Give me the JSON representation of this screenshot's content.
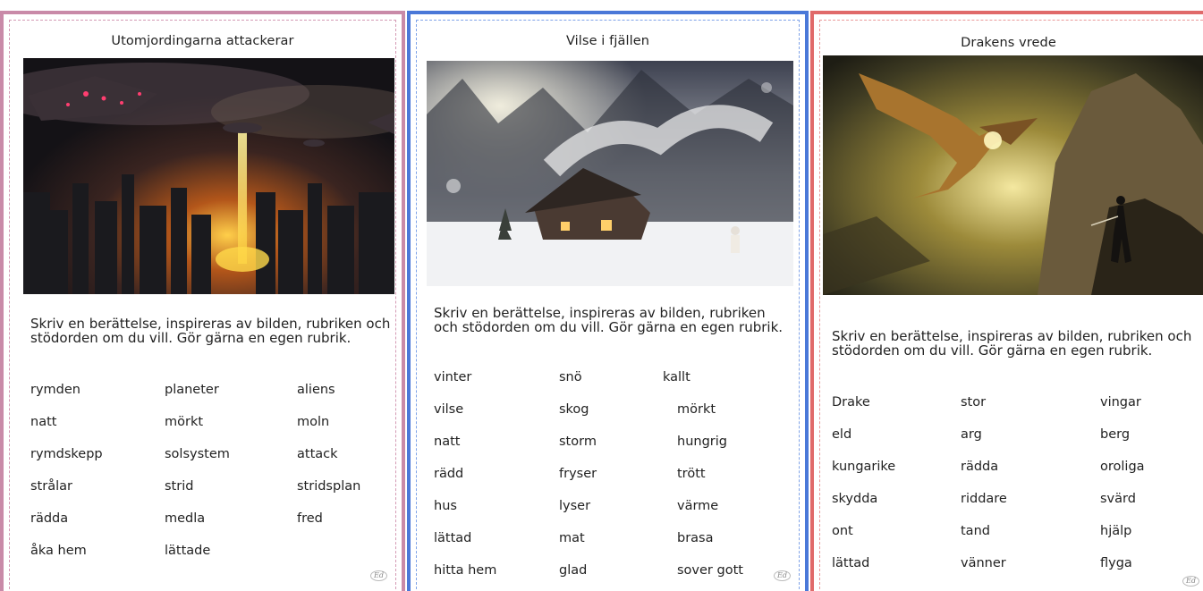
{
  "cards": [
    {
      "title": "Utomjordingarna attackerar",
      "image_subject": "ufo-city-image",
      "prompt": "Skriv en berättelse, inspireras av bilden, rubriken och stödorden om du vill. Gör gärna en egen rubrik.",
      "words": [
        [
          "rymden",
          "planeter",
          "aliens"
        ],
        [
          "natt",
          "mörkt",
          "moln"
        ],
        [
          "rymdskepp",
          "solsystem",
          "attack"
        ],
        [
          "strålar",
          "strid",
          "stridsplan"
        ],
        [
          "rädda",
          "medla",
          "fred"
        ],
        [
          "åka hem",
          "lättade",
          ""
        ]
      ],
      "accent": "#c98aa8"
    },
    {
      "title": "Vilse i fjällen",
      "image_subject": "snowy-cabin-image",
      "prompt": "Skriv en berättelse, inspireras av bilden, rubriken och stödorden om du vill. Gör gärna en egen rubrik.",
      "words": [
        [
          "vinter",
          "snö",
          "kallt"
        ],
        [
          "vilse",
          "skog",
          "mörkt"
        ],
        [
          "natt",
          "storm",
          "hungrig"
        ],
        [
          "rädd",
          "fryser",
          "trött"
        ],
        [
          "hus",
          "lyser",
          "värme"
        ],
        [
          "lättad",
          "mat",
          "brasa"
        ],
        [
          "hitta hem",
          "glad",
          "sover gott"
        ]
      ],
      "accent": "#4a78d8"
    },
    {
      "title": "Drakens vrede",
      "image_subject": "dragon-mountain-image",
      "prompt": "Skriv en berättelse, inspireras av bilden, rubriken och stödorden om du vill. Gör gärna en egen rubrik.",
      "words": [
        [
          "Drake",
          "stor",
          "vingar"
        ],
        [
          "eld",
          "arg",
          "berg"
        ],
        [
          "kungarike",
          "rädda",
          "oroliga"
        ],
        [
          "skydda",
          "riddare",
          "svärd"
        ],
        [
          "ont",
          "tand",
          "hjälp"
        ],
        [
          "lättad",
          "vänner",
          "flyga"
        ]
      ],
      "accent": "#e06a6a"
    }
  ]
}
